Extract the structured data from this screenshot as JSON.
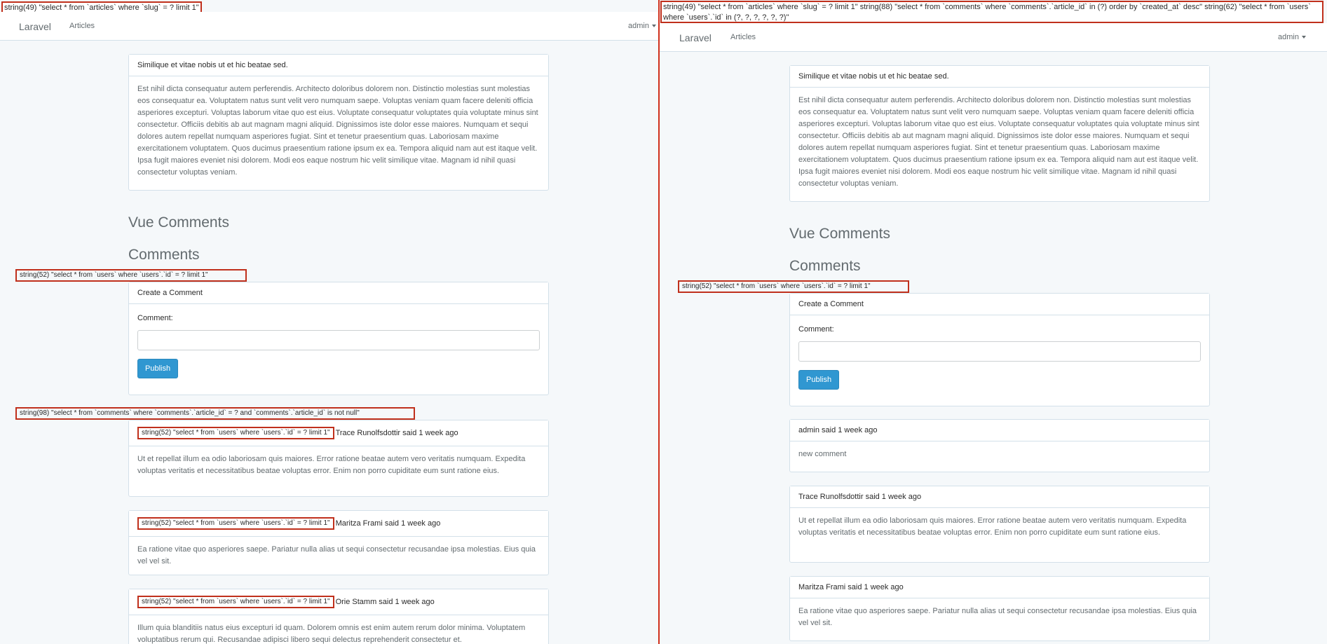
{
  "left": {
    "debug_top": "string(49) \"select * from `articles` where `slug` = ? limit 1\"",
    "nav": {
      "brand": "Laravel",
      "link_articles": "Articles",
      "user": "admin"
    },
    "article": {
      "title": "Similique et vitae nobis ut et hic beatae sed.",
      "body": "Est nihil dicta consequatur autem perferendis. Architecto doloribus dolorem non. Distinctio molestias sunt molestias eos consequatur ea. Voluptatem natus sunt velit vero numquam saepe. Voluptas veniam quam facere deleniti officia asperiores excepturi. Voluptas laborum vitae quo est eius. Voluptate consequatur voluptates quia voluptate minus sint consectetur. Officiis debitis ab aut magnam magni aliquid. Dignissimos iste dolor esse maiores. Numquam et sequi dolores autem repellat numquam asperiores fugiat. Sint et tenetur praesentium quas. Laboriosam maxime exercitationem voluptatem. Quos ducimus praesentium ratione ipsum ex ea. Tempora aliquid nam aut est itaque velit. Ipsa fugit maiores eveniet nisi dolorem. Modi eos eaque nostrum hic velit similique vitae. Magnam id nihil quasi consectetur voluptas veniam."
    },
    "vue_comments_title": "Vue Comments",
    "comments_title": "Comments",
    "debug_users": "string(52) \"select * from `users` where `users`.`id` = ? limit 1\"",
    "create": {
      "heading": "Create a Comment",
      "label": "Comment:",
      "placeholder": "",
      "button": "Publish"
    },
    "debug_comments": "string(98) \"select * from `comments` where `comments`.`article_id` = ? and `comments`.`article_id` is not null\"",
    "comments": [
      {
        "debug": "string(52) \"select * from `users` where `users`.`id` = ? limit 1\"",
        "meta": "Trace Runolfsdottir said 1 week ago",
        "body": "Ut et repellat illum ea odio laboriosam quis maiores. Error ratione beatae autem vero veritatis numquam. Expedita voluptas veritatis et necessitatibus beatae voluptas error. Enim non porro cupiditate eum sunt ratione eius."
      },
      {
        "debug": "string(52) \"select * from `users` where `users`.`id` = ? limit 1\"",
        "meta": "Maritza Frami said 1 week ago",
        "body": "Ea ratione vitae quo asperiores saepe. Pariatur nulla alias ut sequi consectetur recusandae ipsa molestias. Eius quia vel vel sit."
      },
      {
        "debug": "string(52) \"select * from `users` where `users`.`id` = ? limit 1\"",
        "meta": "Orie Stamm said 1 week ago",
        "body": "Illum quia blanditiis natus eius excepturi id quam. Dolorem omnis est enim autem rerum dolor minima. Voluptatem voluptatibus rerum qui. Recusandae adipisci libero sequi delectus reprehenderit consectetur et."
      }
    ]
  },
  "right": {
    "debug_top": "string(49) \"select * from `articles` where `slug` = ? limit 1\" string(88) \"select * from `comments` where `comments`.`article_id` in (?) order by `created_at` desc\" string(62) \"select * from `users` where `users`.`id` in (?, ?, ?, ?, ?, ?)\"",
    "nav": {
      "brand": "Laravel",
      "link_articles": "Articles",
      "user": "admin"
    },
    "article": {
      "title": "Similique et vitae nobis ut et hic beatae sed.",
      "body": "Est nihil dicta consequatur autem perferendis. Architecto doloribus dolorem non. Distinctio molestias sunt molestias eos consequatur ea. Voluptatem natus sunt velit vero numquam saepe. Voluptas veniam quam facere deleniti officia asperiores excepturi. Voluptas laborum vitae quo est eius. Voluptate consequatur voluptates quia voluptate minus sint consectetur. Officiis debitis ab aut magnam magni aliquid. Dignissimos iste dolor esse maiores. Numquam et sequi dolores autem repellat numquam asperiores fugiat. Sint et tenetur praesentium quas. Laboriosam maxime exercitationem voluptatem. Quos ducimus praesentium ratione ipsum ex ea. Tempora aliquid nam aut est itaque velit. Ipsa fugit maiores eveniet nisi dolorem. Modi eos eaque nostrum hic velit similique vitae. Magnam id nihil quasi consectetur voluptas veniam."
    },
    "vue_comments_title": "Vue Comments",
    "comments_title": "Comments",
    "debug_users": "string(52) \"select * from `users` where `users`.`id` = ? limit 1\"",
    "create": {
      "heading": "Create a Comment",
      "label": "Comment:",
      "placeholder": "",
      "button": "Publish"
    },
    "comments": [
      {
        "meta": "admin said 1 week ago",
        "body": "new comment"
      },
      {
        "meta": "Trace Runolfsdottir said 1 week ago",
        "body": "Ut et repellat illum ea odio laboriosam quis maiores. Error ratione beatae autem vero veritatis numquam. Expedita voluptas veritatis et necessitatibus beatae voluptas error. Enim non porro cupiditate eum sunt ratione eius."
      },
      {
        "meta": "Maritza Frami said 1 week ago",
        "body": "Ea ratione vitae quo asperiores saepe. Pariatur nulla alias ut sequi consectetur recusandae ipsa molestias. Eius quia vel vel sit."
      }
    ]
  },
  "colors": {
    "highlight_border": "#c0301c",
    "primary_button": "#3097d1",
    "background": "#f5f8fa"
  }
}
